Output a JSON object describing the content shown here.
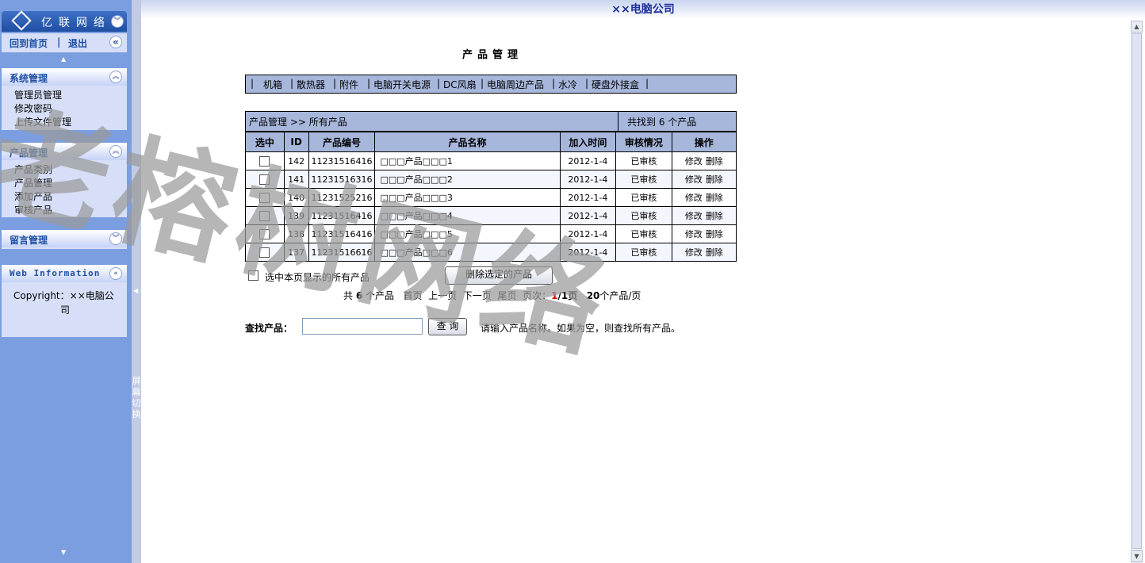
{
  "sidebar": {
    "logo_text": "亿联网络",
    "nav_home": "回到首页",
    "nav_sep": "|",
    "nav_logout": "退出",
    "sections": [
      {
        "title": "系统管理",
        "items": [
          "管理员管理",
          "修改密码",
          "上传文件管理"
        ]
      },
      {
        "title": "产品管理",
        "items": [
          "产品类别",
          "产品管理",
          "添加产品",
          "审核产品"
        ]
      },
      {
        "title": "留言管理",
        "items": []
      },
      {
        "title": "Web Information",
        "items": []
      }
    ],
    "copyright_line1": "Copyright：××电脑公",
    "copyright_line2": "司",
    "splitter_text": "屏幕切换"
  },
  "header": {
    "company": "××电脑公司"
  },
  "main": {
    "title": "产品管理",
    "categories": [
      "机箱",
      "散热器",
      "附件",
      "电脑开关电源",
      "DC风扇",
      "电脑周边产品",
      "水冷",
      "硬盘外接盒"
    ],
    "breadcrumb": "产品管理 >> 所有产品",
    "found_text": "共找到 6 个产品",
    "columns": [
      "选中",
      "ID",
      "产品编号",
      "产品名称",
      "加入时间",
      "审核情况",
      "操作"
    ],
    "rows": [
      {
        "id": "142",
        "code": "11231516416",
        "name": "□□□产品□□□1",
        "date": "2012-1-4",
        "status": "已审核"
      },
      {
        "id": "141",
        "code": "11231516316",
        "name": "□□□产品□□□2",
        "date": "2012-1-4",
        "status": "已审核"
      },
      {
        "id": "140",
        "code": "11231525216",
        "name": "□□□产品□□□3",
        "date": "2012-1-4",
        "status": "已审核"
      },
      {
        "id": "139",
        "code": "11231516416",
        "name": "□□□产品□□□4",
        "date": "2012-1-4",
        "status": "已审核"
      },
      {
        "id": "138",
        "code": "11231516416",
        "name": "□□□产品□□□5",
        "date": "2012-1-4",
        "status": "已审核"
      },
      {
        "id": "137",
        "code": "11231516616",
        "name": "□□□产品□□□6",
        "date": "2012-1-4",
        "status": "已审核"
      }
    ],
    "op_edit": "修改",
    "op_delete": "删除",
    "select_all_label": "选中本页显示的所有产品",
    "delete_selected_btn": "删除选定的产品",
    "pager": {
      "total_prefix": "共",
      "total": "6",
      "total_suffix": "个产品",
      "first": "首页",
      "prev": "上一页",
      "next": "下一页",
      "last": "尾页",
      "page_label": "页次：",
      "current": "1",
      "pages": "/1页",
      "per_page": "20",
      "per_page_suffix": "个产品/页"
    },
    "search": {
      "label": "查找产品：",
      "value": "",
      "button": "查 询",
      "hint": "请输入产品名称。如果为空，则查找所有产品。"
    }
  },
  "watermark": "老榕树网络",
  "colors": {
    "sidebar": "#7b9ee0",
    "header_blue": "#a7b7dc",
    "title_text": "#1d2e9b"
  }
}
